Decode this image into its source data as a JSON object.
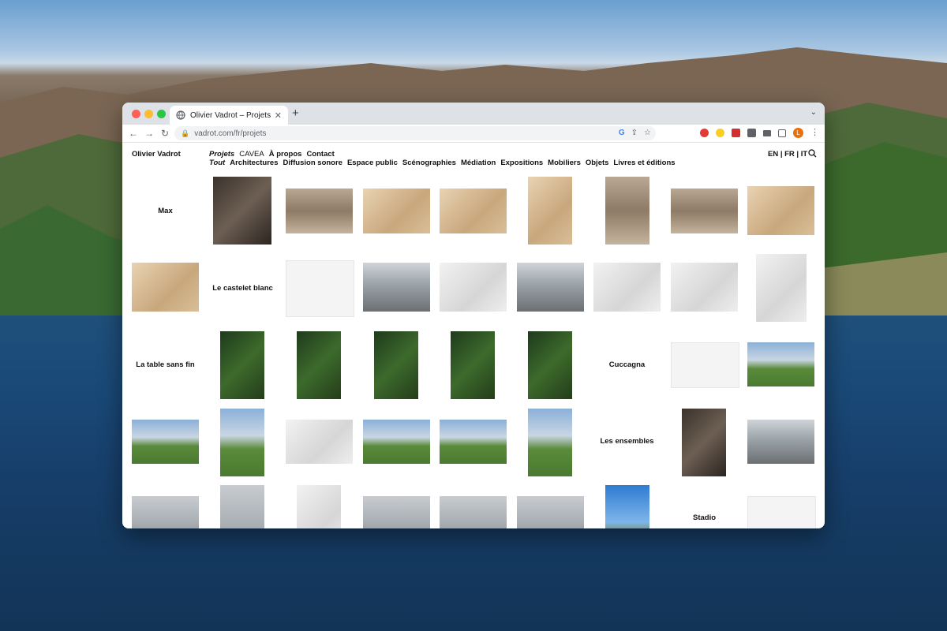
{
  "browser": {
    "tab_title": "Olivier Vadrot – Projets",
    "url": "vadrot.com/fr/projets",
    "profile_initial": "L"
  },
  "site": {
    "title": "Olivier Vadrot",
    "nav_primary": [
      "Projets",
      "CAVEA",
      "À propos",
      "Contact"
    ],
    "nav_categories": [
      "Tout",
      "Architectures",
      "Diffusion sonore",
      "Espace public",
      "Scénographies",
      "Médiation",
      "Expositions",
      "Mobiliers",
      "Objets",
      "Livres et éditions"
    ],
    "languages": "EN | FR | IT"
  },
  "projects": [
    "Max",
    "Le castelet blanc",
    "La table sans fin",
    "Cuccagna",
    "Les ensembles",
    "Stadio"
  ],
  "colors": {
    "accent_red": "#ff5f57",
    "accent_yellow": "#febc2e",
    "accent_green": "#28c840",
    "profile": "#e8710a"
  }
}
